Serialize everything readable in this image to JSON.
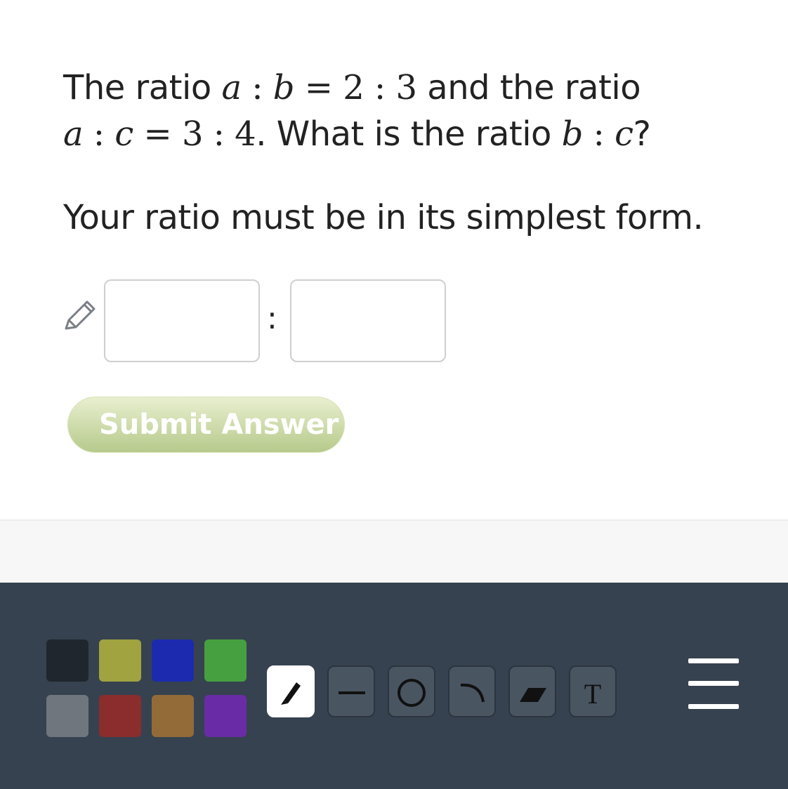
{
  "question": {
    "line1": {
      "t1": "The ratio ",
      "a": "a",
      "c1": " : ",
      "b": "b",
      "eq": " = ",
      "n1": "2",
      "c2": " : ",
      "n2": "3",
      "t2": " and the ratio"
    },
    "line2": {
      "a": "a",
      "c1": " : ",
      "c": "c",
      "eq": " = ",
      "n1": "3",
      "c2": " : ",
      "n2": "4",
      "t1": ". What is the ratio ",
      "b": "b",
      "c3": " : ",
      "c2v": "c",
      "t2": "?"
    },
    "instruction": "Your ratio must be in its simplest form."
  },
  "answer": {
    "separator": ":",
    "first_value": "",
    "second_value": ""
  },
  "submit": {
    "label": "Submit Answer",
    "color_top": "#e8efcf",
    "color_bottom": "#b7ca8c"
  },
  "toolbar": {
    "background": "#36424f",
    "colors": [
      "#1f262e",
      "#a0a340",
      "#1c2aaf",
      "#46a03f",
      "#6f767d",
      "#8b2d2d",
      "#936b39",
      "#6a2ca6"
    ],
    "tools": [
      {
        "icon": "marker-icon",
        "active": true
      },
      {
        "icon": "line-icon",
        "active": false
      },
      {
        "icon": "circle-icon",
        "active": false
      },
      {
        "icon": "arc-icon",
        "active": false
      },
      {
        "icon": "eraser-icon",
        "active": false
      },
      {
        "icon": "text-icon",
        "active": false,
        "label": "T"
      }
    ],
    "menu_icon": "menu-icon"
  }
}
